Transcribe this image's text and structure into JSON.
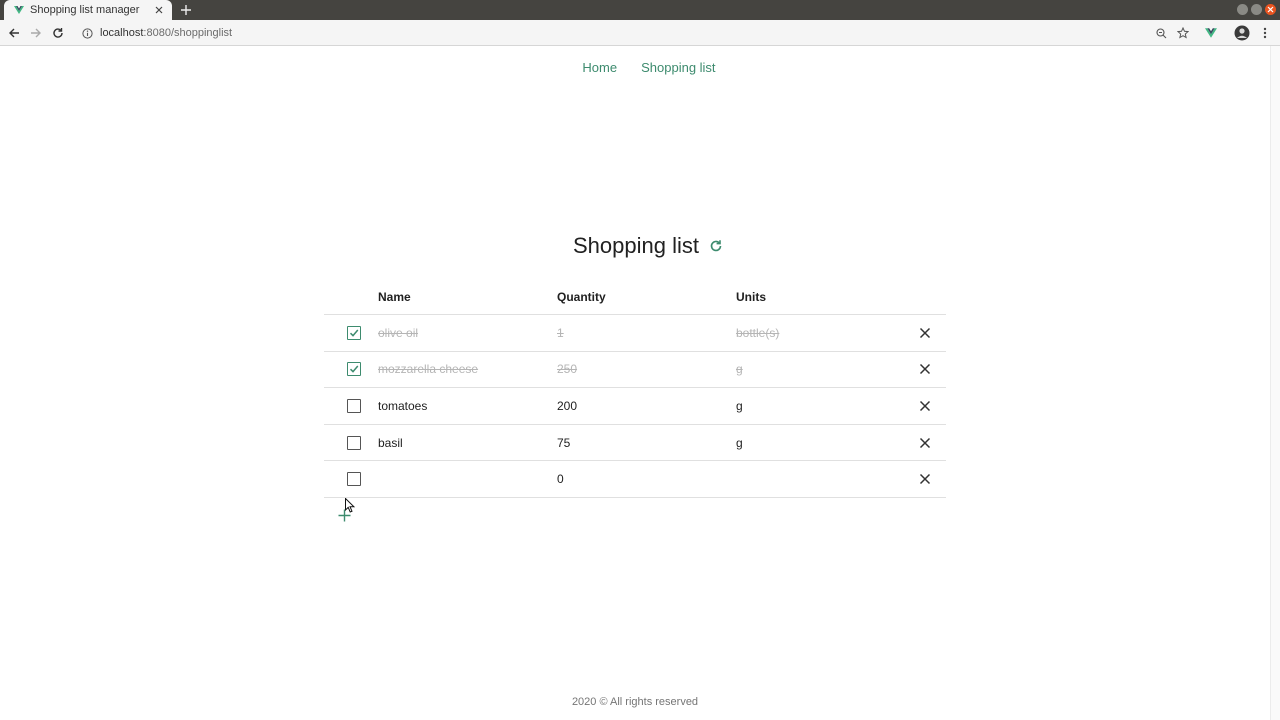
{
  "browser": {
    "tab_title": "Shopping list manager",
    "url_host": "localhost",
    "url_rest": ":8080/shoppinglist"
  },
  "nav": {
    "home": "Home",
    "shopping_list": "Shopping list"
  },
  "page": {
    "title": "Shopping list"
  },
  "table": {
    "headers": {
      "name": "Name",
      "quantity": "Quantity",
      "units": "Units"
    },
    "rows": [
      {
        "checked": true,
        "name": "olive oil",
        "quantity": "1",
        "units": "bottle(s)"
      },
      {
        "checked": true,
        "name": "mozzarella cheese",
        "quantity": "250",
        "units": "g"
      },
      {
        "checked": false,
        "name": "tomatoes",
        "quantity": "200",
        "units": "g"
      },
      {
        "checked": false,
        "name": "basil",
        "quantity": "75",
        "units": "g"
      },
      {
        "checked": false,
        "name": "",
        "quantity": "0",
        "units": ""
      }
    ]
  },
  "footer": {
    "text": "2020 © All rights reserved"
  },
  "colors": {
    "accent": "#3d8b6e",
    "done_text": "#b5b5b5"
  }
}
